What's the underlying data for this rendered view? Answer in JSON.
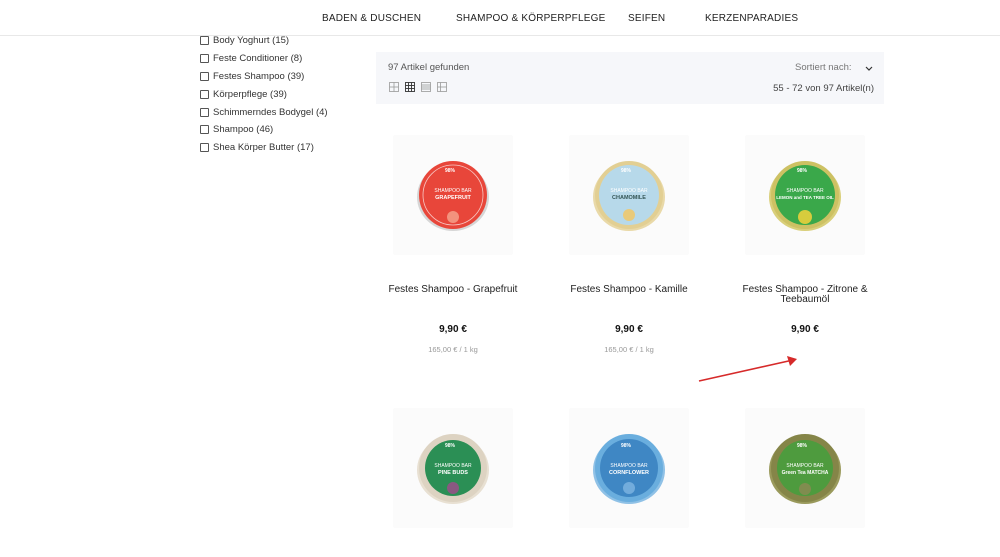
{
  "nav": {
    "items": [
      "BADEN & DUSCHEN",
      "SHAMPOO & KÖRPERPFLEGE",
      "SEIFEN",
      "KERZENPARADIES"
    ]
  },
  "filters": {
    "items": [
      "Body Yoghurt (15)",
      "Feste Conditioner (8)",
      "Festes Shampoo (39)",
      "Körperpflege (39)",
      "Schimmerndes Bodygel (4)",
      "Shampoo (46)",
      "Shea Körper Butter (17)"
    ]
  },
  "toolbar": {
    "found": "97 Artikel gefunden",
    "sort_label": "Sortiert nach:",
    "range": "55 - 72 von 97 Artikel(n)"
  },
  "products": [
    {
      "title": "Festes Shampoo - Grapefruit",
      "price": "9,90 €",
      "unit_price": "165,00 € / 1 kg",
      "color": "#e8463a",
      "label_text": "GRAPEFRUIT",
      "accent": "#f4a08a"
    },
    {
      "title": "Festes Shampoo - Kamille",
      "price": "9,90 €",
      "unit_price": "165,00 € / 1 kg",
      "color": "#b7d9ea",
      "label_text": "CHAMOMILE",
      "accent": "#f2c766"
    },
    {
      "title": "Festes Shampoo - Zitrone & Teebaumöl",
      "price": "9,90 €",
      "unit_price": "",
      "color": "#3aa84a",
      "label_text": "LEMON and TEA TREE OIL",
      "accent": "#f3d23b"
    },
    {
      "title": "",
      "price": "",
      "unit_price": "",
      "color": "#2b8f55",
      "label_text": "PINE BUDS",
      "accent": "#9b4f8a"
    },
    {
      "title": "",
      "price": "",
      "unit_price": "",
      "color": "#3f87c4",
      "label_text": "CORNFLOWER",
      "accent": "#7bb3e0"
    },
    {
      "title": "",
      "price": "",
      "unit_price": "",
      "color": "#4e9b3e",
      "label_text": "Green Tea MATCHA",
      "accent": "#8a8a52"
    }
  ],
  "soap_common": {
    "badge": "98%",
    "subtitle": "SHAMPOO BAR"
  }
}
